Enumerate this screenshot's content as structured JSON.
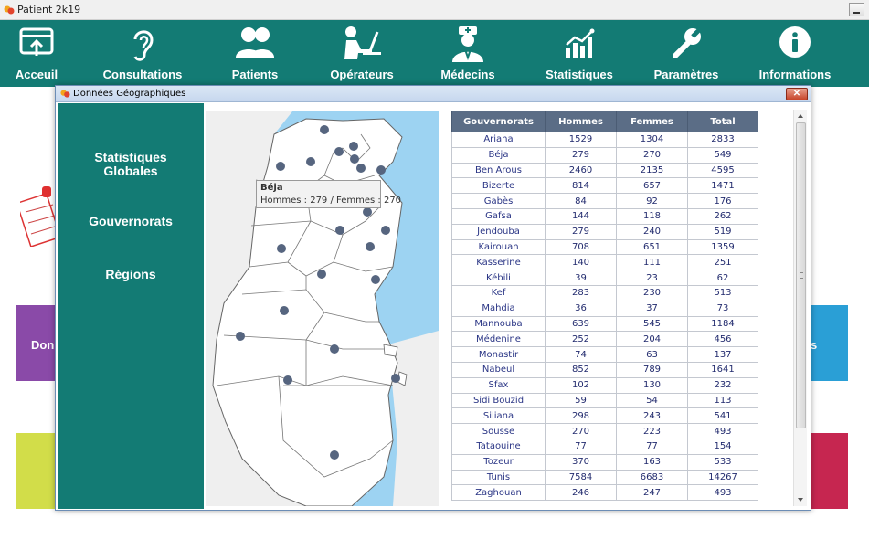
{
  "app": {
    "title": "Patient 2k19"
  },
  "toolbar": {
    "items": [
      {
        "label": "Acceuil",
        "icon": "home-screen-icon"
      },
      {
        "label": "Consultations",
        "icon": "ear-icon"
      },
      {
        "label": "Patients",
        "icon": "patients-group-icon"
      },
      {
        "label": "Opérateurs",
        "icon": "operator-desk-icon"
      },
      {
        "label": "Médecins",
        "icon": "doctor-icon"
      },
      {
        "label": "Statistiques",
        "icon": "bar-chart-icon"
      },
      {
        "label": "Paramètres",
        "icon": "wrench-icon"
      },
      {
        "label": "Informations",
        "icon": "info-icon"
      }
    ]
  },
  "background": {
    "left_tile_text": "Don",
    "right_tile_text": "s"
  },
  "dialog": {
    "title": "Données Géographiques",
    "close_label": "✕",
    "sidebar": [
      {
        "label": "Statistiques Globales"
      },
      {
        "label": "Gouvernorats"
      },
      {
        "label": "Régions"
      }
    ],
    "tooltip": {
      "title": "Béja",
      "body": "Hommes : 279 / Femmes : 270"
    },
    "table": {
      "headers": [
        "Gouvernorats",
        "Hommes",
        "Femmes",
        "Total"
      ],
      "rows": [
        [
          "Ariana",
          "1529",
          "1304",
          "2833"
        ],
        [
          "Béja",
          "279",
          "270",
          "549"
        ],
        [
          "Ben Arous",
          "2460",
          "2135",
          "4595"
        ],
        [
          "Bizerte",
          "814",
          "657",
          "1471"
        ],
        [
          "Gabès",
          "84",
          "92",
          "176"
        ],
        [
          "Gafsa",
          "144",
          "118",
          "262"
        ],
        [
          "Jendouba",
          "279",
          "240",
          "519"
        ],
        [
          "Kairouan",
          "708",
          "651",
          "1359"
        ],
        [
          "Kasserine",
          "140",
          "111",
          "251"
        ],
        [
          "Kébili",
          "39",
          "23",
          "62"
        ],
        [
          "Kef",
          "283",
          "230",
          "513"
        ],
        [
          "Mahdia",
          "36",
          "37",
          "73"
        ],
        [
          "Mannouba",
          "639",
          "545",
          "1184"
        ],
        [
          "Médenine",
          "252",
          "204",
          "456"
        ],
        [
          "Monastir",
          "74",
          "63",
          "137"
        ],
        [
          "Nabeul",
          "852",
          "789",
          "1641"
        ],
        [
          "Sfax",
          "102",
          "130",
          "232"
        ],
        [
          "Sidi Bouzid",
          "59",
          "54",
          "113"
        ],
        [
          "Siliana",
          "298",
          "243",
          "541"
        ],
        [
          "Sousse",
          "270",
          "223",
          "493"
        ],
        [
          "Tataouine",
          "77",
          "77",
          "154"
        ],
        [
          "Tozeur",
          "370",
          "163",
          "533"
        ],
        [
          "Tunis",
          "7584",
          "6683",
          "14267"
        ],
        [
          "Zaghouan",
          "246",
          "247",
          "493"
        ]
      ]
    }
  },
  "colors": {
    "teal": "#137b74",
    "table_header": "#5b6d86",
    "sea": "#9dd3f2",
    "marker": "#56657f"
  }
}
